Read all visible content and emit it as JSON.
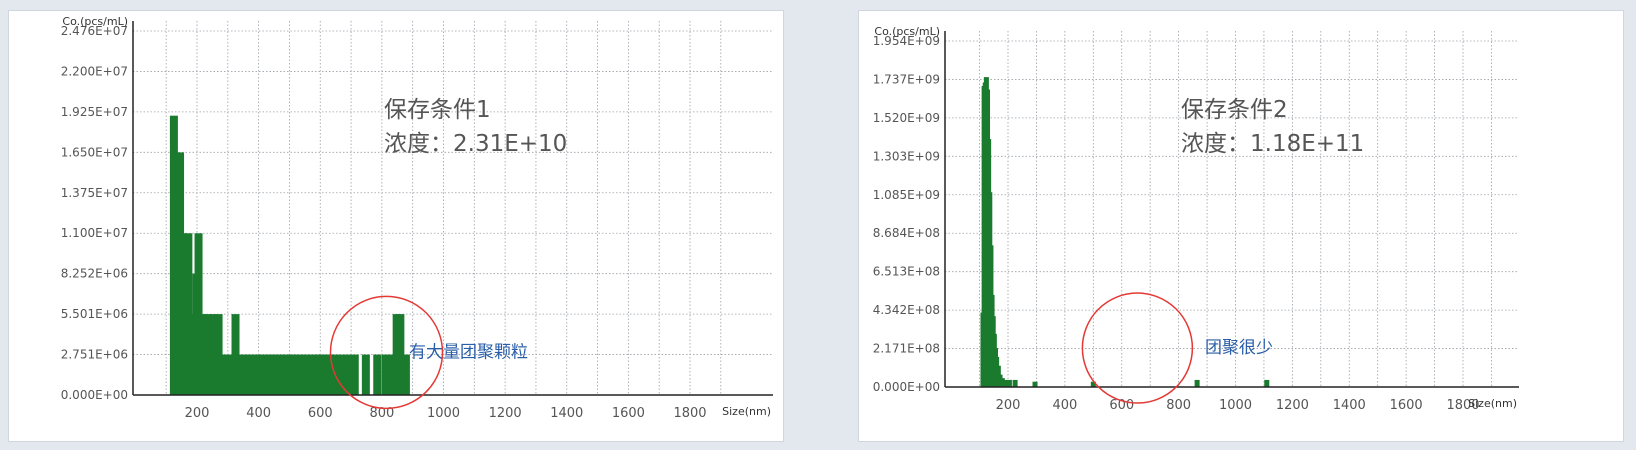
{
  "colors": {
    "bar": "#1a7a2e",
    "circle": "#e53935",
    "annotation": "#2a5ea8",
    "text": "#555555",
    "grid": "#9aa0a6"
  },
  "chart_data": [
    {
      "type": "bar",
      "ylabel": "Co.(pcs/mL)",
      "xlabel": "Size(nm)",
      "ytick_labels": [
        "0.000E+00",
        "2.751E+06",
        "5.501E+06",
        "8.252E+06",
        "1.100E+07",
        "1.375E+07",
        "1.650E+07",
        "1.925E+07",
        "2.200E+07",
        "2.476E+07"
      ],
      "ytick_values": [
        0,
        2751000,
        5501000,
        8252000,
        11000000,
        13750000,
        16500000,
        19250000,
        22000000,
        24760000
      ],
      "xtick_values": [
        200,
        400,
        600,
        800,
        1000,
        1200,
        1400,
        1600,
        1800
      ],
      "xlim": [
        0,
        1900
      ],
      "ylim": [
        0,
        24760000
      ],
      "bar_width": 8,
      "x": [
        125,
        135,
        145,
        150,
        155,
        165,
        172,
        180,
        190,
        198,
        205,
        212,
        220,
        228,
        235,
        243,
        252,
        262,
        270,
        278,
        290,
        300,
        312,
        325,
        332,
        340,
        350,
        360,
        372,
        382,
        392,
        402,
        412,
        422,
        432,
        445,
        455,
        468,
        480,
        490,
        502,
        512,
        522,
        540,
        555,
        570,
        585,
        595,
        605,
        615,
        630,
        645,
        665,
        690,
        712,
        748,
        785,
        812,
        832,
        848,
        860,
        878
      ],
      "values": [
        19000000,
        16500000,
        16500000,
        8252000,
        11000000,
        8252000,
        11000000,
        5501000,
        5501000,
        8252000,
        11000000,
        2751000,
        5501000,
        2751000,
        5501000,
        2751000,
        5501000,
        2751000,
        5501000,
        2751000,
        2751000,
        2751000,
        2751000,
        5501000,
        2751000,
        2751000,
        2751000,
        2751000,
        2751000,
        2751000,
        2751000,
        2751000,
        2751000,
        2751000,
        2751000,
        2751000,
        2751000,
        2751000,
        2751000,
        2751000,
        2751000,
        2751000,
        2751000,
        2751000,
        2751000,
        2751000,
        2751000,
        2751000,
        2751000,
        2751000,
        2751000,
        2751000,
        2751000,
        2751000,
        2751000,
        2751000,
        2751000,
        2751000,
        2751000,
        5501000,
        5501000,
        2751000
      ],
      "title_lines": [
        "保存条件1",
        "浓度：2.31E+10"
      ],
      "annotation": "有大量团聚颗粒",
      "circle_center": [
        815,
        2900000
      ]
    },
    {
      "type": "bar",
      "ylabel": "Co.(pcs/mL)",
      "xlabel": "Size(nm)",
      "ytick_labels": [
        "0.000E+00",
        "2.171E+08",
        "4.342E+08",
        "6.513E+08",
        "8.684E+08",
        "1.085E+09",
        "1.303E+09",
        "1.520E+09",
        "1.737E+09",
        "1.954E+09"
      ],
      "ytick_values": [
        0,
        217100000,
        434200000,
        651300000,
        868400000,
        1085000000,
        1303000000,
        1520000000,
        1737000000,
        1954000000
      ],
      "xtick_values": [
        200,
        400,
        600,
        800,
        1000,
        1200,
        1400,
        1600,
        1800
      ],
      "xlim": [
        0,
        1900
      ],
      "ylim": [
        0,
        1954000000
      ],
      "bar_width": 5,
      "x": [
        112,
        116,
        120,
        124,
        128,
        132,
        136,
        140,
        144,
        148,
        152,
        156,
        160,
        166,
        172,
        180,
        190,
        205,
        225,
        295,
        500,
        865,
        1110
      ],
      "values": [
        420000000,
        1700000000,
        1720000000,
        1750000000,
        1680000000,
        1400000000,
        1100000000,
        800000000,
        520000000,
        400000000,
        300000000,
        220000000,
        170000000,
        120000000,
        70000000,
        50000000,
        40000000,
        40000000,
        40000000,
        30000000,
        30000000,
        40000000,
        40000000
      ],
      "title_lines": [
        "保存条件2",
        "浓度：1.18E+11"
      ],
      "annotation": "团聚很少",
      "circle_center": [
        655,
        220000000
      ]
    }
  ]
}
